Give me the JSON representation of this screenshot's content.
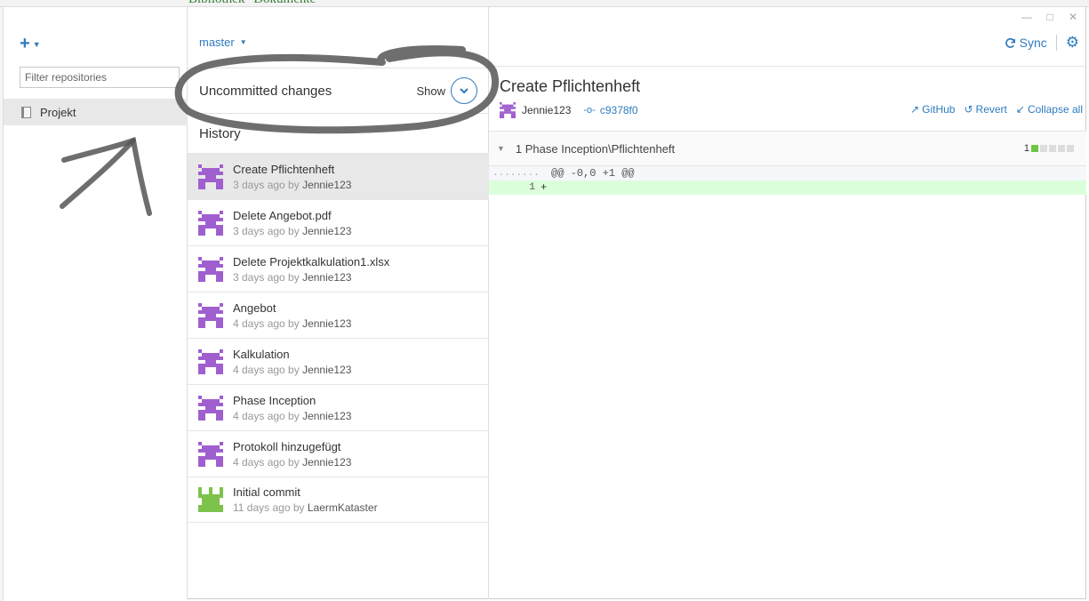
{
  "background": {
    "title": "Bibliothek \"Dokumente\""
  },
  "window": {
    "controls": [
      "minimize-icon",
      "maximize-icon",
      "close-icon"
    ]
  },
  "sidebar": {
    "add_icon": "plus-icon",
    "filter_placeholder": "Filter repositories",
    "repositories": [
      {
        "name": "Projekt"
      }
    ]
  },
  "branch": {
    "name": "master"
  },
  "uncommitted": {
    "label": "Uncommitted changes",
    "show_label": "Show"
  },
  "history": {
    "heading": "History",
    "commits": [
      {
        "title": "Create Pflichtenheft",
        "age": "3 days ago by",
        "author": "Jennie123",
        "selected": true
      },
      {
        "title": "Delete Angebot.pdf",
        "age": "3 days ago by",
        "author": "Jennie123"
      },
      {
        "title": "Delete Projektkalkulation1.xlsx",
        "age": "3 days ago by",
        "author": "Jennie123"
      },
      {
        "title": "Angebot",
        "age": "4 days ago by",
        "author": "Jennie123"
      },
      {
        "title": "Kalkulation",
        "age": "4 days ago by",
        "author": "Jennie123"
      },
      {
        "title": "Phase Inception",
        "age": "4 days ago by",
        "author": "Jennie123"
      },
      {
        "title": "Protokoll hinzugefügt",
        "age": "4 days ago by",
        "author": "Jennie123"
      },
      {
        "title": "Initial commit",
        "age": "11 days ago by",
        "author": "LaermKataster"
      }
    ]
  },
  "toolbar": {
    "sync_label": "Sync"
  },
  "detail": {
    "title": "Create Pflichtenheft",
    "author": "Jennie123",
    "sha": "c9378f0",
    "actions": {
      "github": "GitHub",
      "revert": "Revert",
      "collapse": "Collapse all"
    },
    "file": {
      "path": "1 Phase Inception\\Pflichtenheft",
      "additions": "1"
    },
    "diff": {
      "hunk_gutter_left": "....",
      "hunk_gutter_right": "....",
      "hunk": "@@ -0,0 +1 @@",
      "line_number": "1",
      "line_text": "+"
    }
  },
  "colors": {
    "accent": "#2f7bbf",
    "avatar_purple": "#a05fcf",
    "avatar_green": "#7dc24b",
    "added_line": "#dbffdb"
  }
}
